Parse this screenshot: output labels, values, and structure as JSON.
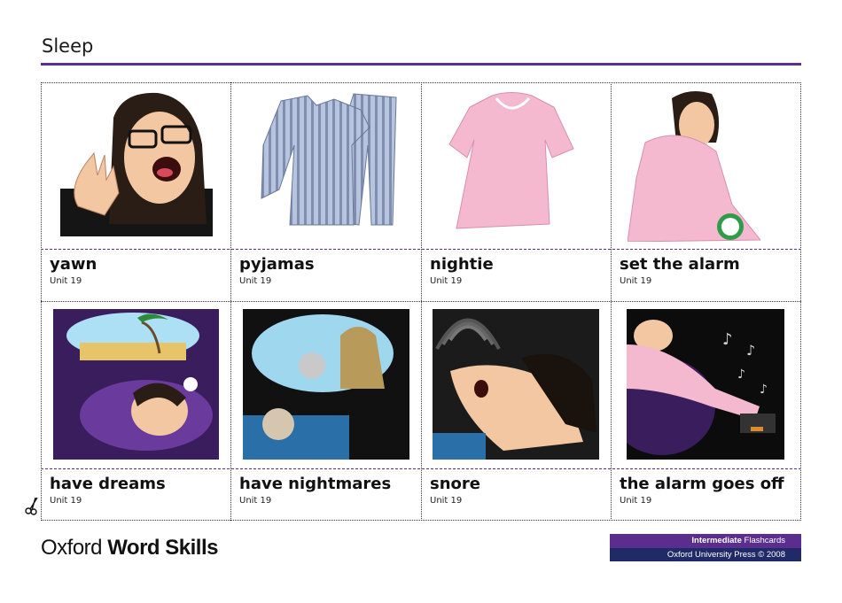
{
  "header": {
    "title": "Sleep"
  },
  "cards": [
    {
      "word": "yawn",
      "unit": "Unit 19",
      "image": "yawning-woman"
    },
    {
      "word": "pyjamas",
      "unit": "Unit 19",
      "image": "striped-pyjamas"
    },
    {
      "word": "nightie",
      "unit": "Unit 19",
      "image": "pink-nightie"
    },
    {
      "word": "set the alarm",
      "unit": "Unit 19",
      "image": "woman-setting-alarm-clock"
    },
    {
      "word": "have dreams",
      "unit": "Unit 19",
      "image": "woman-dreaming-of-beach"
    },
    {
      "word": "have nightmares",
      "unit": "Unit 19",
      "image": "child-with-monster-nightmare"
    },
    {
      "word": "snore",
      "unit": "Unit 19",
      "image": "man-snoring"
    },
    {
      "word": "the alarm goes off",
      "unit": "Unit 19",
      "image": "woman-reaching-for-alarm"
    }
  ],
  "footer": {
    "brand_light": "Oxford",
    "brand_bold": "Word Skills",
    "level_bold": "Intermediate",
    "level_rest": "Flashcards",
    "publisher": "Oxford University Press © 2008"
  },
  "colors": {
    "accent": "#5b2d8e",
    "navy": "#1f2a66"
  }
}
